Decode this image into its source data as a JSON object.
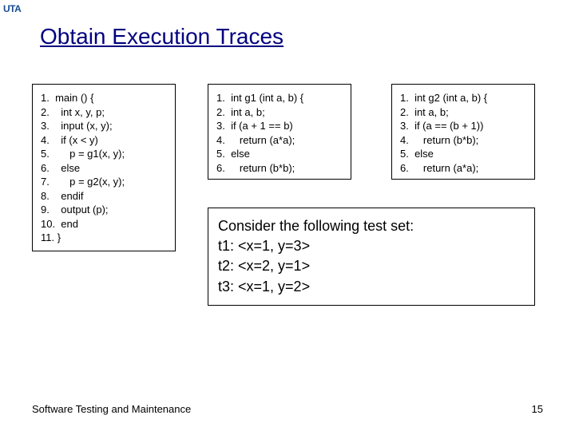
{
  "logo": "UTA",
  "title": "Obtain Execution Traces",
  "code_main": [
    "1.  main () {",
    "2.    int x, y, p;",
    "3.    input (x, y);",
    "4.    if (x < y)",
    "5.       p = g1(x, y);",
    "6.    else",
    "7.       p = g2(x, y);",
    "8.    endif",
    "9.    output (p);",
    "10.  end",
    "11. }"
  ],
  "code_g1": [
    "1.  int g1 (int a, b) {",
    "2.  int a, b;",
    "3.  if (a + 1 == b)",
    "4.     return (a*a);",
    "5.  else",
    "6.     return (b*b);"
  ],
  "code_g2": [
    "1.  int g2 (int a, b) {",
    "2.  int a, b;",
    "3.  if (a == (b + 1))",
    "4.     return (b*b);",
    "5.  else",
    "6.     return (a*a);"
  ],
  "testset": {
    "intro": "Consider the following test set:",
    "rows": [
      "t1: <x=1, y=3>",
      "t2: <x=2, y=1>",
      "t3: <x=1, y=2>"
    ]
  },
  "footer_left": "Software Testing and Maintenance",
  "footer_right": "15"
}
